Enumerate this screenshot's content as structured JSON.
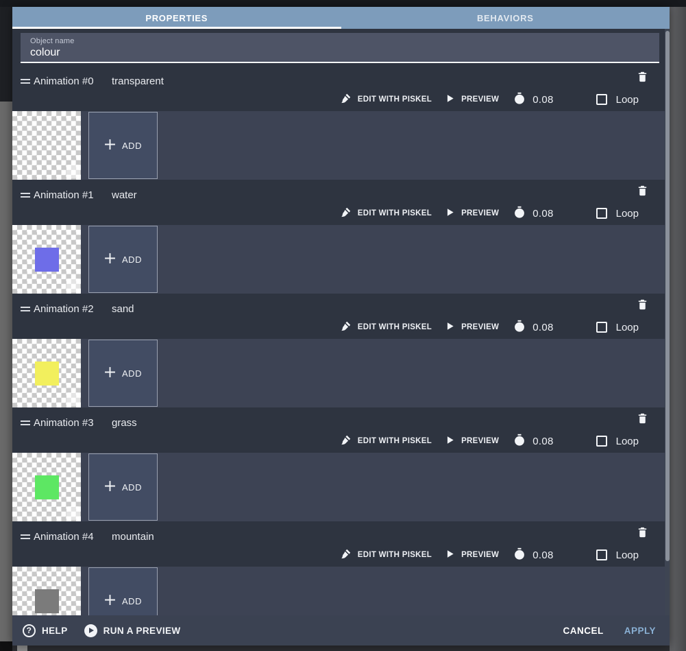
{
  "dialog": {
    "tabs": [
      {
        "label": "PROPERTIES",
        "active": true
      },
      {
        "label": "BEHAVIORS",
        "active": false
      }
    ],
    "object_name": {
      "label": "Object name",
      "value": "colour"
    },
    "labels": {
      "edit_with_piskel": "EDIT WITH PISKEL",
      "preview": "PREVIEW",
      "loop": "Loop",
      "add": "ADD"
    },
    "animations": [
      {
        "title": "Animation #0",
        "name": "transparent",
        "time_between_frames": "0.08",
        "loop_checked": false,
        "swatch": ""
      },
      {
        "title": "Animation #1",
        "name": "water",
        "time_between_frames": "0.08",
        "loop_checked": false,
        "swatch": "#6e6de8"
      },
      {
        "title": "Animation #2",
        "name": "sand",
        "time_between_frames": "0.08",
        "loop_checked": false,
        "swatch": "#f2ef5d"
      },
      {
        "title": "Animation #3",
        "name": "grass",
        "time_between_frames": "0.08",
        "loop_checked": false,
        "swatch": "#5de763"
      },
      {
        "title": "Animation #4",
        "name": "mountain",
        "time_between_frames": "0.08",
        "loop_checked": false,
        "swatch": "#7b7b7b"
      }
    ],
    "footer": {
      "help": "HELP",
      "run_preview": "RUN A PREVIEW",
      "cancel": "CANCEL",
      "apply": "APPLY"
    },
    "icons": {
      "help_glyph": "?"
    },
    "colors": {
      "tab_bar": "#7d9cbb",
      "apply": "#8ab0d4",
      "header_bg": "#2e3440",
      "frames_row_bg": "#3d4354"
    }
  }
}
